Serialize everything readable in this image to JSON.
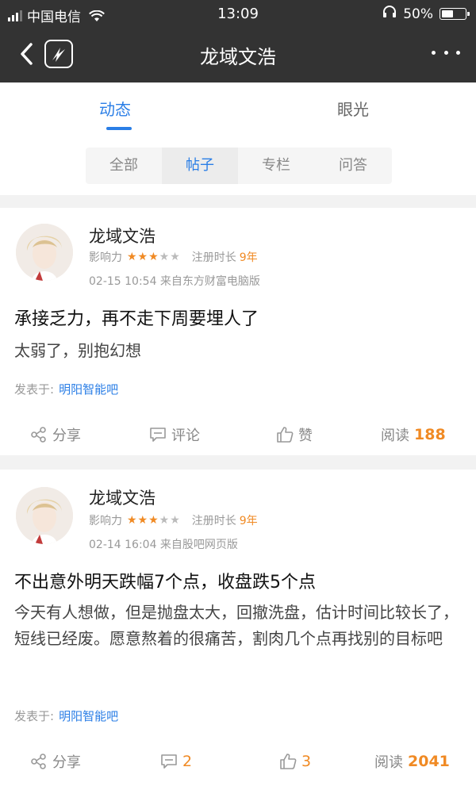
{
  "status_bar": {
    "carrier": "中国电信",
    "time": "13:09",
    "battery": "50%",
    "battery_level": 0.5
  },
  "nav": {
    "title": "龙域文浩",
    "back_icon": "chevron-left-icon",
    "logo_icon": "app-logo-icon",
    "more_icon": "more-dots-icon"
  },
  "tabs": [
    {
      "label": "动态",
      "active": true
    },
    {
      "label": "眼光",
      "active": false
    }
  ],
  "subtabs": [
    {
      "label": "全部",
      "active": false
    },
    {
      "label": "帖子",
      "active": true
    },
    {
      "label": "专栏",
      "active": false
    },
    {
      "label": "问答",
      "active": false
    }
  ],
  "labels": {
    "influence": "影响力",
    "registered": "注册时长",
    "posted_in": "发表于:",
    "share": "分享",
    "comment": "评论",
    "like": "赞",
    "reads": "阅读"
  },
  "colors": {
    "accent": "#2a7ee6",
    "highlight": "#f08a24",
    "topbar": "#333333"
  },
  "posts": [
    {
      "author": "龙域文浩",
      "stars_filled": 3,
      "stars_total": 5,
      "reg_years": "9年",
      "date_source": "02-15 10:54  来自东方财富电脑版",
      "title": "承接乏力，再不走下周要埋人了",
      "body": "太弱了，别抱幻想",
      "board": "明阳智能吧",
      "comments": "评论",
      "likes": "赞",
      "reads": "188"
    },
    {
      "author": "龙域文浩",
      "stars_filled": 3,
      "stars_total": 5,
      "reg_years": "9年",
      "date_source": "02-14 16:04  来自股吧网页版",
      "title": "不出意外明天跌幅7个点，收盘跌5个点",
      "body": "今天有人想做，但是抛盘太大，回撤洗盘，估计时间比较长了，短线已经废。愿意熬着的很痛苦，割肉几个点再找别的目标吧",
      "board": "明阳智能吧",
      "comments": "2",
      "likes": "3",
      "reads": "2041"
    }
  ]
}
